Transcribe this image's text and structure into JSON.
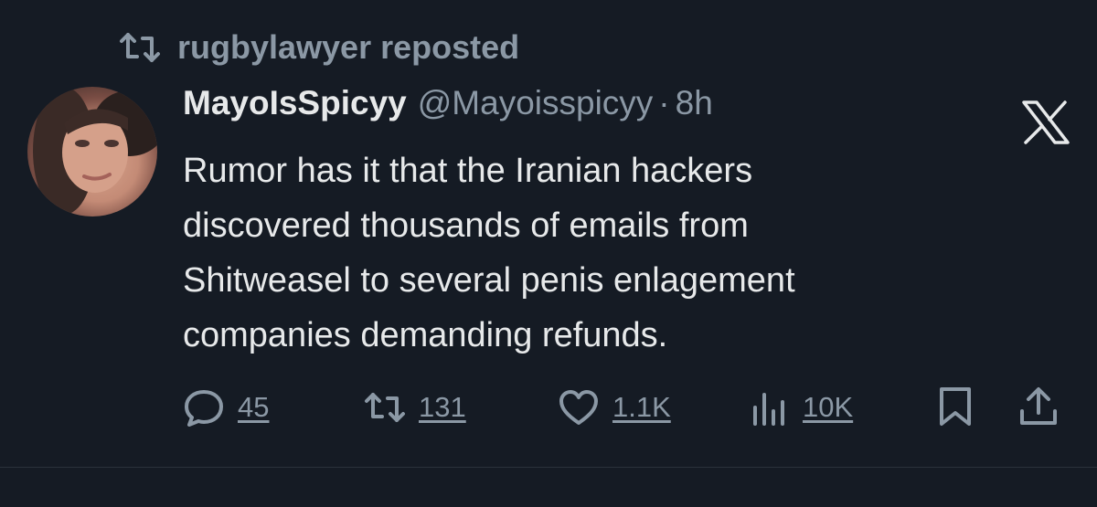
{
  "repost": {
    "text": "rugbylawyer reposted",
    "icon": "repost-icon"
  },
  "author": {
    "display_name": "MayoIsSpicyy",
    "handle": "@Mayoisspicyy",
    "separator": "·",
    "time": "8h",
    "avatar_icon": "avatar-photo"
  },
  "brand_icon": "x-logo-icon",
  "tweet": {
    "lines": [
      "Rumor has it that the Iranian hackers",
      "discovered thousands of emails from",
      "Shitweasel to several penis enlagement",
      "companies demanding refunds."
    ]
  },
  "actions": {
    "replies": "45",
    "reposts": "131",
    "likes": "1.1K",
    "views": "10K",
    "bookmark_icon": "bookmark-icon",
    "share_icon": "share-icon"
  },
  "colors": {
    "background": "#151b24",
    "text_primary": "#e7e9ea",
    "text_secondary": "#8b98a5"
  }
}
